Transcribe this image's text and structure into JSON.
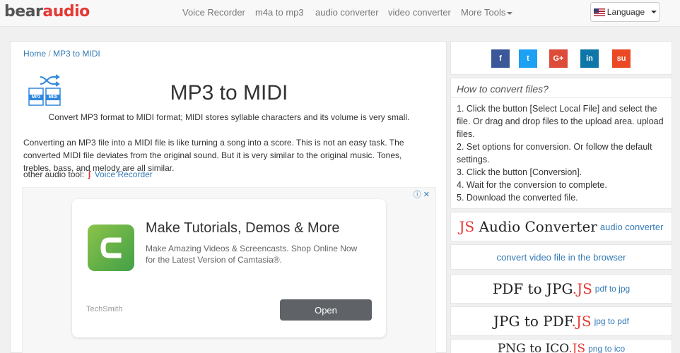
{
  "logo": {
    "part1": "bear",
    "part2": "audio"
  },
  "nav": {
    "items": [
      "Voice Recorder",
      "m4a to mp3",
      "audio converter",
      "video converter"
    ],
    "more": "More Tools",
    "language": "Language"
  },
  "breadcrumb": {
    "home": "Home",
    "separator": " / ",
    "current": "MP3 to MIDI"
  },
  "tool_icon": {
    "left_label": "MP3",
    "right_label": "MIDI"
  },
  "page": {
    "title": "MP3 to MIDI",
    "subtitle": "Convert MP3 format to MIDI format; MIDI stores syllable characters and its volume is very small.",
    "description": "Converting an MP3 file into a MIDI file is like turning a song into a score. This is not an easy task. The converted MIDI file deviates from the original sound. But it is very similar to the original music. Tones, trebles, bass, and melody are all similar.",
    "other_tools_label": "other audio tool:",
    "other_tools_link": "Voice Recorder"
  },
  "ad": {
    "choices": "ⓘ ✕",
    "headline": "Make Tutorials, Demos & More",
    "body": "Make Amazing Videos & Screencasts. Shop Online Now for the Latest Version of Camtasia®.",
    "advertiser": "TechSmith",
    "cta": "Open"
  },
  "share": {
    "buttons": [
      {
        "label": "f",
        "color": "#3b5998"
      },
      {
        "label": "t",
        "color": "#1da1f2"
      },
      {
        "label": "G+",
        "color": "#dd4b39"
      },
      {
        "label": "in",
        "color": "#0e76a8"
      },
      {
        "label": "su",
        "color": "#eb4924"
      }
    ]
  },
  "howto": {
    "title": "How to convert files?",
    "steps": [
      "1. Click the button [Select Local File] and select the file. Or drag and drop files to the upload area. upload files.",
      "2. Set options for conversion. Or follow the default settings.",
      "3. Click the button [Conversion].",
      "4. Wait for the conversion to complete.",
      "5. Download the converted file."
    ]
  },
  "sidebar_links": {
    "js_audio": {
      "js": "JS",
      "name": " Audio Converter",
      "link": "audio converter"
    },
    "video": {
      "link": "convert video file in the browser"
    },
    "pdf_jpg": {
      "name": "PDF to JPG",
      "js": ".JS",
      "link": "pdf to jpg"
    },
    "jpg_pdf": {
      "name": "JPG to PDF",
      "js": ".JS",
      "link": "jpg to pdf"
    },
    "png_ico": {
      "name": "PNG to ICO",
      "js": ".JS",
      "link": "png to ico"
    }
  }
}
